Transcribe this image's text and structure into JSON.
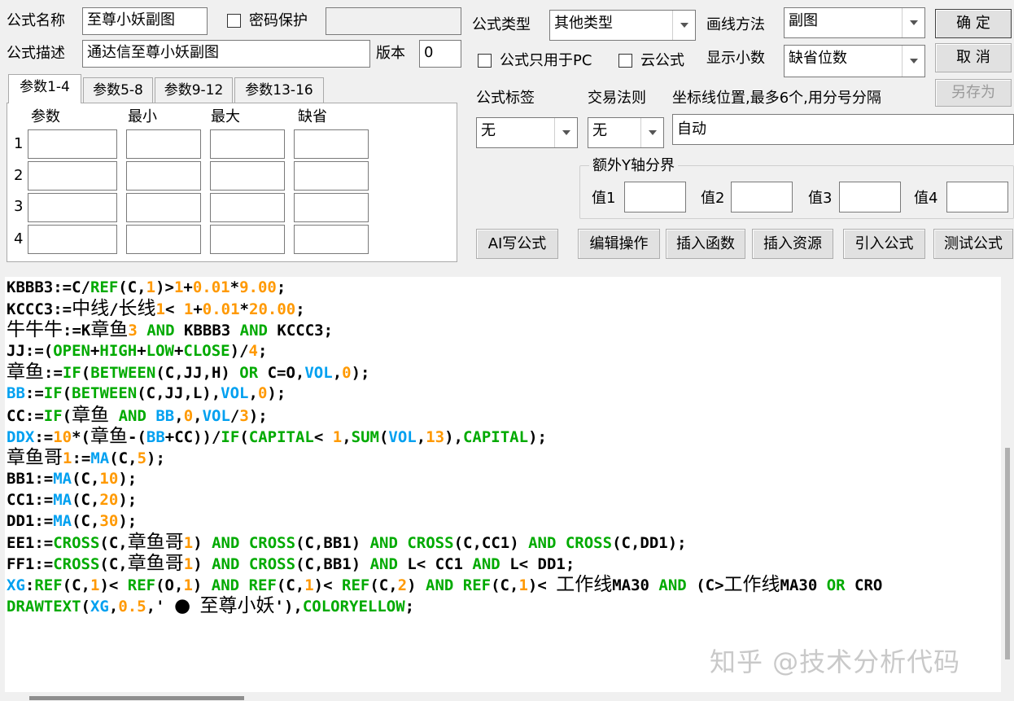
{
  "header": {
    "formula_name_label": "公式名称",
    "formula_name_value": "至尊小妖副图",
    "password_label": "密码保护",
    "password_value": "",
    "formula_desc_label": "公式描述",
    "formula_desc_value": "通达信至尊小妖副图",
    "version_label": "版本",
    "version_value": "0",
    "formula_type_label": "公式类型",
    "formula_type_value": "其他类型",
    "draw_method_label": "画线方法",
    "draw_method_value": "副图",
    "pc_only_label": "公式只用于PC",
    "cloud_label": "云公式",
    "decimals_label": "显示小数",
    "decimals_value": "缺省位数"
  },
  "buttons": {
    "ok": "确 定",
    "cancel": "取 消",
    "save_as": "另存为",
    "ai": "AI写公式",
    "edit": "编辑操作",
    "insert_func": "插入函数",
    "insert_res": "插入资源",
    "import": "引入公式",
    "test": "测试公式"
  },
  "tabs": [
    {
      "label": "参数1-4"
    },
    {
      "label": "参数5-8"
    },
    {
      "label": "参数9-12"
    },
    {
      "label": "参数13-16"
    }
  ],
  "params": {
    "headers": [
      "参数",
      "最小",
      "最大",
      "缺省"
    ],
    "rows": [
      "1",
      "2",
      "3",
      "4"
    ]
  },
  "right": {
    "tag_label": "公式标签",
    "tag_value": "无",
    "trade_label": "交易法则",
    "trade_value": "无",
    "axis_label": "坐标线位置,最多6个,用分号分隔",
    "axis_value": "自动",
    "extra_y_label": "额外Y轴分界",
    "val_labels": [
      "值1",
      "值2",
      "值3",
      "值4"
    ]
  },
  "code_lines": [
    "KBBB3:=C/REF(C,1)>1+0.01*9.00;",
    "KCCC3:=中线/长线1< 1+0.01*20.00;",
    "牛牛牛:=K章鱼3 AND KBBB3 AND KCCC3;",
    "JJ:=(OPEN+HIGH+LOW+CLOSE)/4;",
    "章鱼:=IF(BETWEEN(C,JJ,H) OR C=O,VOL,0);",
    "BB:=IF(BETWEEN(C,JJ,L),VOL,0);",
    "CC:=IF(章鱼 AND BB,0,VOL/3);",
    "DDX:=10*(章鱼-(BB+CC))/IF(CAPITAL< 1,SUM(VOL,13),CAPITAL);",
    "章鱼哥1:=MA(C,5);",
    "BB1:=MA(C,10);",
    "CC1:=MA(C,20);",
    "DD1:=MA(C,30);",
    "EE1:=CROSS(C,章鱼哥1) AND CROSS(C,BB1) AND CROSS(C,CC1) AND CROSS(C,DD1);",
    "FF1:=CROSS(C,章鱼哥1) AND CROSS(C,BB1) AND L< CC1 AND L< DD1;",
    "XG:REF(C,1)< REF(O,1) AND REF(C,1)< REF(C,2) AND REF(C,1)< 工作线MA30 AND (C>工作线MA30 OR CRO",
    "DRAWTEXT(XG,0.5,' ● 至尊小妖'),COLORYELLOW;"
  ],
  "watermark": "知乎 @技术分析代码"
}
